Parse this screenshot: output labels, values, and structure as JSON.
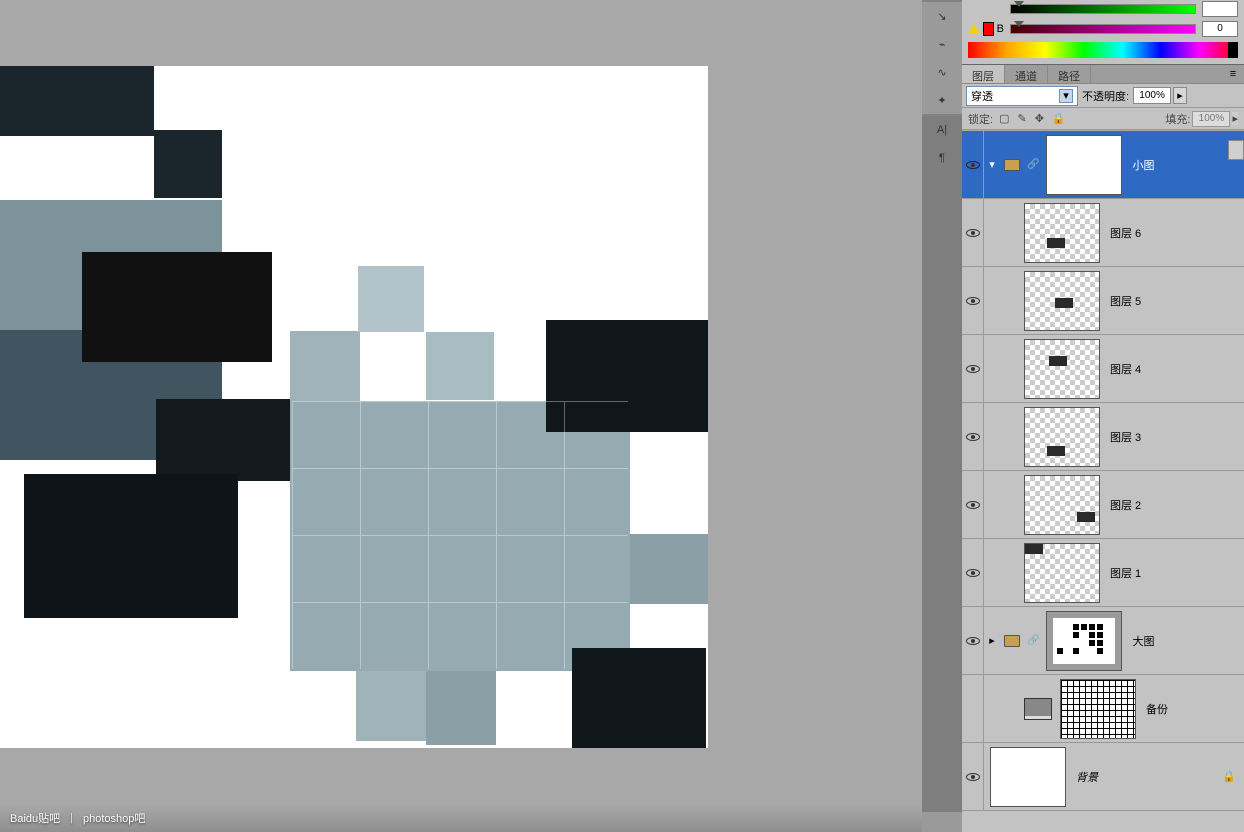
{
  "color": {
    "channel_label": "B",
    "value_b": "0",
    "value_top": ""
  },
  "panel": {
    "tabs": {
      "layers": "图层",
      "channels": "通道",
      "paths": "路径"
    },
    "blend_mode": "穿透",
    "opacity_label": "不透明度:",
    "opacity_value": "100%",
    "lock_label": "锁定:",
    "fill_label": "填充:",
    "fill_value": "100%"
  },
  "layers": [
    {
      "name": "小图",
      "type": "group",
      "visible": true,
      "selected": true
    },
    {
      "name": "图层 6",
      "type": "layer",
      "visible": true
    },
    {
      "name": "图层 5",
      "type": "layer",
      "visible": true
    },
    {
      "name": "图层 4",
      "type": "layer",
      "visible": true
    },
    {
      "name": "图层 3",
      "type": "layer",
      "visible": true
    },
    {
      "name": "图层 2",
      "type": "layer",
      "visible": true
    },
    {
      "name": "图层 1",
      "type": "layer",
      "visible": true
    },
    {
      "name": "大图",
      "type": "group-collapsed",
      "visible": true
    },
    {
      "name": "备份",
      "type": "layer",
      "visible": false
    },
    {
      "name": "背景",
      "type": "bg",
      "visible": true,
      "locked": true
    }
  ],
  "watermark": {
    "brand": "Baidu贴吧",
    "separator": "|",
    "board": "photoshop吧"
  }
}
